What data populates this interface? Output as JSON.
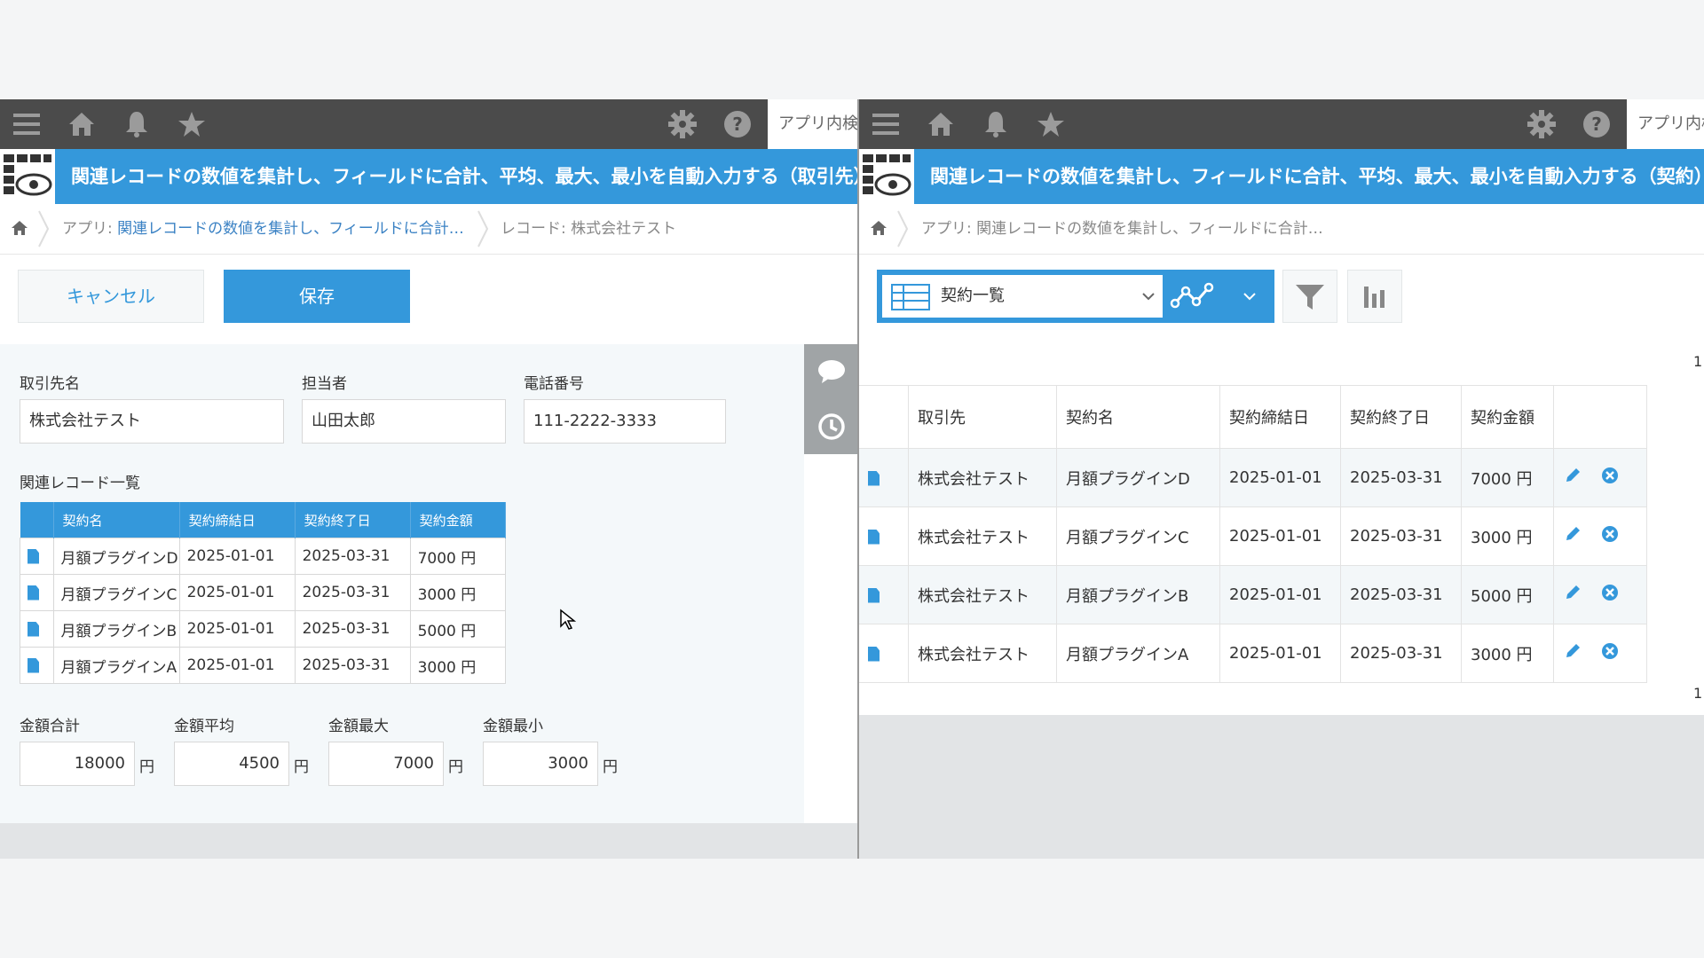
{
  "left": {
    "topbar": {
      "icons": [
        "menu-icon",
        "home-icon",
        "bell-icon",
        "star-icon",
        "gear-icon",
        "help-icon"
      ],
      "search_placeholder": "アプリ内検"
    },
    "app_title": "関連レコードの数値を集計し、フィールドに合計、平均、最大、最小を自動入力する（取引先）",
    "breadcrumb": {
      "app_prefix": "アプリ: ",
      "app_link": "関連レコードの数値を集計し、フィールドに合計…",
      "record": "レコード: 株式会社テスト"
    },
    "buttons": {
      "cancel": "キャンセル",
      "save": "保存"
    },
    "fields": {
      "company_label": "取引先名",
      "company_value": "株式会社テスト",
      "person_label": "担当者",
      "person_value": "山田太郎",
      "phone_label": "電話番号",
      "phone_value": "111-2222-3333"
    },
    "related": {
      "label": "関連レコード一覧",
      "columns": [
        "契約名",
        "契約締結日",
        "契約終了日",
        "契約金額"
      ],
      "rows": [
        [
          "月額プラグインD",
          "2025-01-01",
          "2025-03-31",
          "7000 円"
        ],
        [
          "月額プラグインC",
          "2025-01-01",
          "2025-03-31",
          "3000 円"
        ],
        [
          "月額プラグインB",
          "2025-01-01",
          "2025-03-31",
          "5000 円"
        ],
        [
          "月額プラグインA",
          "2025-01-01",
          "2025-03-31",
          "3000 円"
        ]
      ]
    },
    "totals": [
      {
        "label": "金額合計",
        "value": "18000",
        "unit": "円"
      },
      {
        "label": "金額平均",
        "value": "4500",
        "unit": "円"
      },
      {
        "label": "金額最大",
        "value": "7000",
        "unit": "円"
      },
      {
        "label": "金額最小",
        "value": "3000",
        "unit": "円"
      }
    ]
  },
  "right": {
    "topbar": {
      "search_placeholder": "アプリ内検"
    },
    "app_title": "関連レコードの数値を集計し、フィールドに合計、平均、最大、最小を自動入力する（契約）",
    "breadcrumb": {
      "app": "アプリ: 関連レコードの数値を集計し、フィールドに合計…"
    },
    "view_select": "契約一覧",
    "pager_top": "1",
    "pager_bottom": "1",
    "columns": [
      "取引先",
      "契約名",
      "契約締結日",
      "契約終了日",
      "契約金額"
    ],
    "rows": [
      [
        "株式会社テスト",
        "月額プラグインD",
        "2025-01-01",
        "2025-03-31",
        "7000 円"
      ],
      [
        "株式会社テスト",
        "月額プラグインC",
        "2025-01-01",
        "2025-03-31",
        "3000 円"
      ],
      [
        "株式会社テスト",
        "月額プラグインB",
        "2025-01-01",
        "2025-03-31",
        "5000 円"
      ],
      [
        "株式会社テスト",
        "月額プラグインA",
        "2025-01-01",
        "2025-03-31",
        "3000 円"
      ]
    ]
  },
  "colors": {
    "header": "#4b4b4b",
    "accent": "#3498db",
    "form_bg": "#f4f8fa"
  }
}
